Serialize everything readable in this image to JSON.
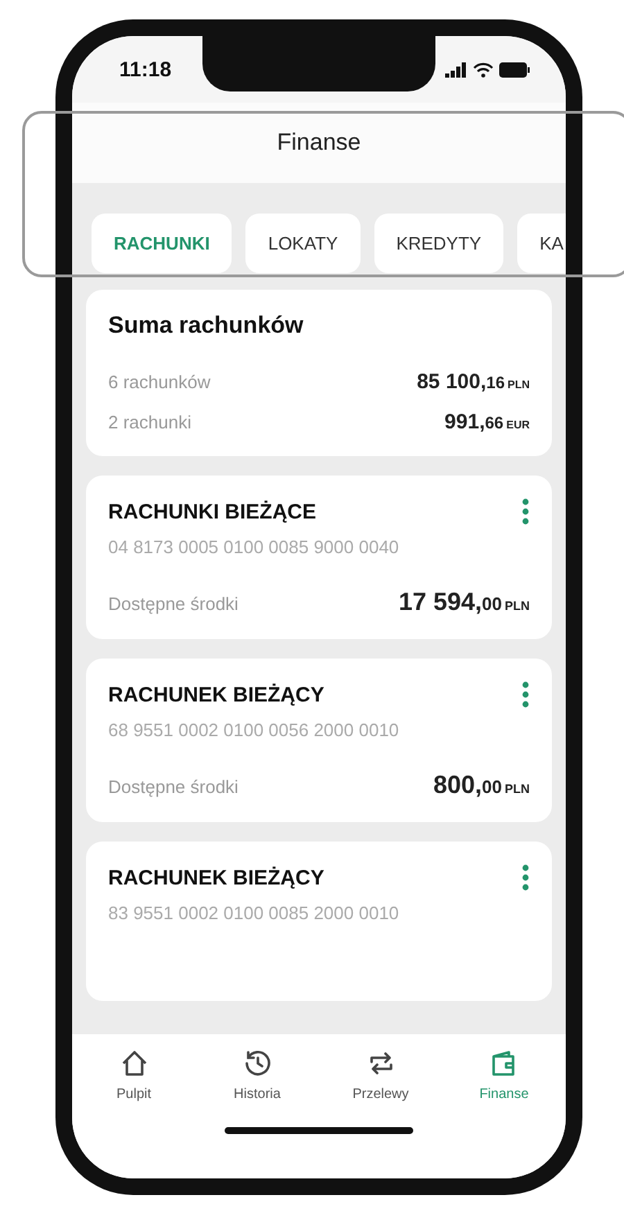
{
  "status_bar": {
    "time": "11:18"
  },
  "header": {
    "title": "Finanse"
  },
  "tabs": [
    {
      "label": "RACHUNKI",
      "selected": true
    },
    {
      "label": "LOKATY",
      "selected": false
    },
    {
      "label": "KREDYTY",
      "selected": false
    },
    {
      "label": "KA",
      "selected": false
    }
  ],
  "cards": [
    {
      "kind": "summary",
      "title": "Suma rachunków",
      "rows": [
        {
          "label": "6 rachunków",
          "amount": {
            "main": "85 100,",
            "fraction": "16",
            "currency": "PLN"
          }
        },
        {
          "label": "2 rachunki",
          "amount": {
            "main": "991,",
            "fraction": "66",
            "currency": "EUR"
          }
        }
      ]
    },
    {
      "kind": "account",
      "title": "RACHUNKI BIEŻĄCE",
      "number": "04 8173 0005 0100 0085 9000 0040",
      "balance_label": "Dostępne środki",
      "balance": {
        "main": "17 594,",
        "fraction": "00",
        "currency": "PLN"
      }
    },
    {
      "kind": "account",
      "title": "RACHUNEK BIEŻĄCY",
      "number": "68 9551 0002 0100 0056 2000 0010",
      "balance_label": "Dostępne środki",
      "balance": {
        "main": "800,",
        "fraction": "00",
        "currency": "PLN"
      }
    },
    {
      "kind": "account",
      "title": "RACHUNEK BIEŻĄCY",
      "number": "83 9551 0002 0100 0085 2000 0010"
    }
  ],
  "nav": [
    {
      "label": "Pulpit",
      "selected": false
    },
    {
      "label": "Historia",
      "selected": false
    },
    {
      "label": "Przelewy",
      "selected": false
    },
    {
      "label": "Finanse",
      "selected": true
    }
  ]
}
